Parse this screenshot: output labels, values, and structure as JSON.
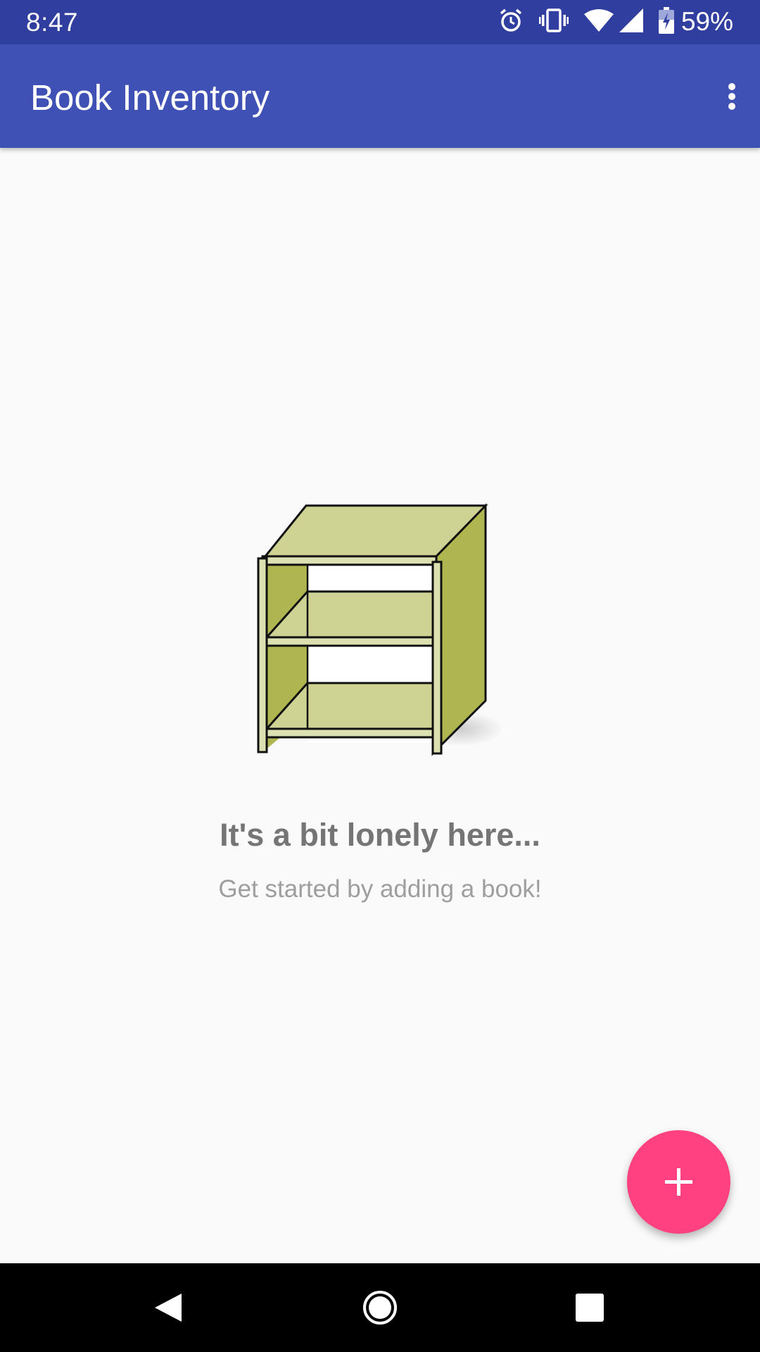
{
  "status_bar": {
    "time": "8:47",
    "battery": "59%",
    "icons": [
      "alarm-icon",
      "vibrate-icon",
      "wifi-icon",
      "cell-signal-icon",
      "battery-charging-icon"
    ]
  },
  "app_bar": {
    "title": "Book Inventory",
    "overflow_icon": "more-vert-icon"
  },
  "empty_state": {
    "illustration": "bookshelf-illustration",
    "title": "It's a bit lonely here...",
    "subtitle": "Get started by adding a book!"
  },
  "fab": {
    "icon": "add-icon",
    "color": "#ff4081"
  },
  "nav_bar": {
    "buttons": [
      "back-icon",
      "home-icon",
      "recents-icon"
    ]
  },
  "colors": {
    "primary": "#3f51b5",
    "primary_dark": "#303f9f",
    "accent": "#ff4081",
    "background": "#fafafa"
  }
}
